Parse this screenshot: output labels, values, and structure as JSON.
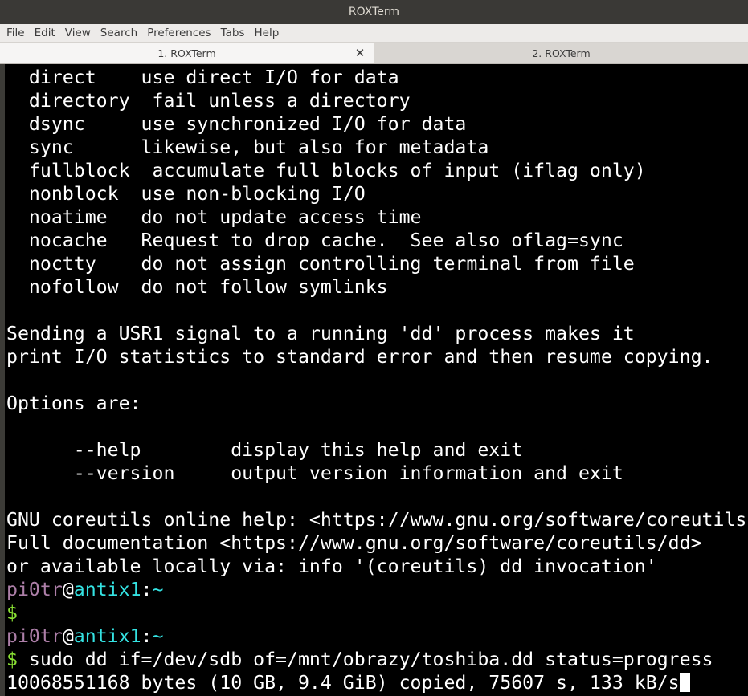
{
  "window": {
    "title": "ROXTerm"
  },
  "menu": [
    "File",
    "Edit",
    "View",
    "Search",
    "Preferences",
    "Tabs",
    "Help"
  ],
  "tabs": [
    {
      "label": "1. ROXTerm",
      "active": true
    },
    {
      "label": "2. ROXTerm",
      "active": false
    }
  ],
  "terminal": {
    "output": [
      "  direct    use direct I/O for data",
      "  directory  fail unless a directory",
      "  dsync     use synchronized I/O for data",
      "  sync      likewise, but also for metadata",
      "  fullblock  accumulate full blocks of input (iflag only)",
      "  nonblock  use non-blocking I/O",
      "  noatime   do not update access time",
      "  nocache   Request to drop cache.  See also oflag=sync",
      "  noctty    do not assign controlling terminal from file",
      "  nofollow  do not follow symlinks",
      "",
      "Sending a USR1 signal to a running 'dd' process makes it",
      "print I/O statistics to standard error and then resume copying.",
      "",
      "Options are:",
      "",
      "      --help        display this help and exit",
      "      --version     output version information and exit",
      "",
      "GNU coreutils online help: <https://www.gnu.org/software/coreutils/>",
      "Full documentation <https://www.gnu.org/software/coreutils/dd>",
      "or available locally via: info '(coreutils) dd invocation'"
    ],
    "prompt": {
      "user": "pi0tr",
      "at": "@",
      "host": "antix1",
      "colon": ":",
      "path": "~",
      "symbol": "$"
    },
    "empty_command": "",
    "command": " sudo dd if=/dev/sdb of=/mnt/obrazy/toshiba.dd status=progress",
    "progress_line": "10068551168 bytes (10 GB, 9.4 GiB) copied, 75607 s, 133 kB/s",
    "colors": {
      "user": "#ad7fa8",
      "host": "#34e2e2",
      "prompt_symbol": "#8ae234",
      "background": "#000000",
      "foreground": "#ffffff"
    }
  }
}
